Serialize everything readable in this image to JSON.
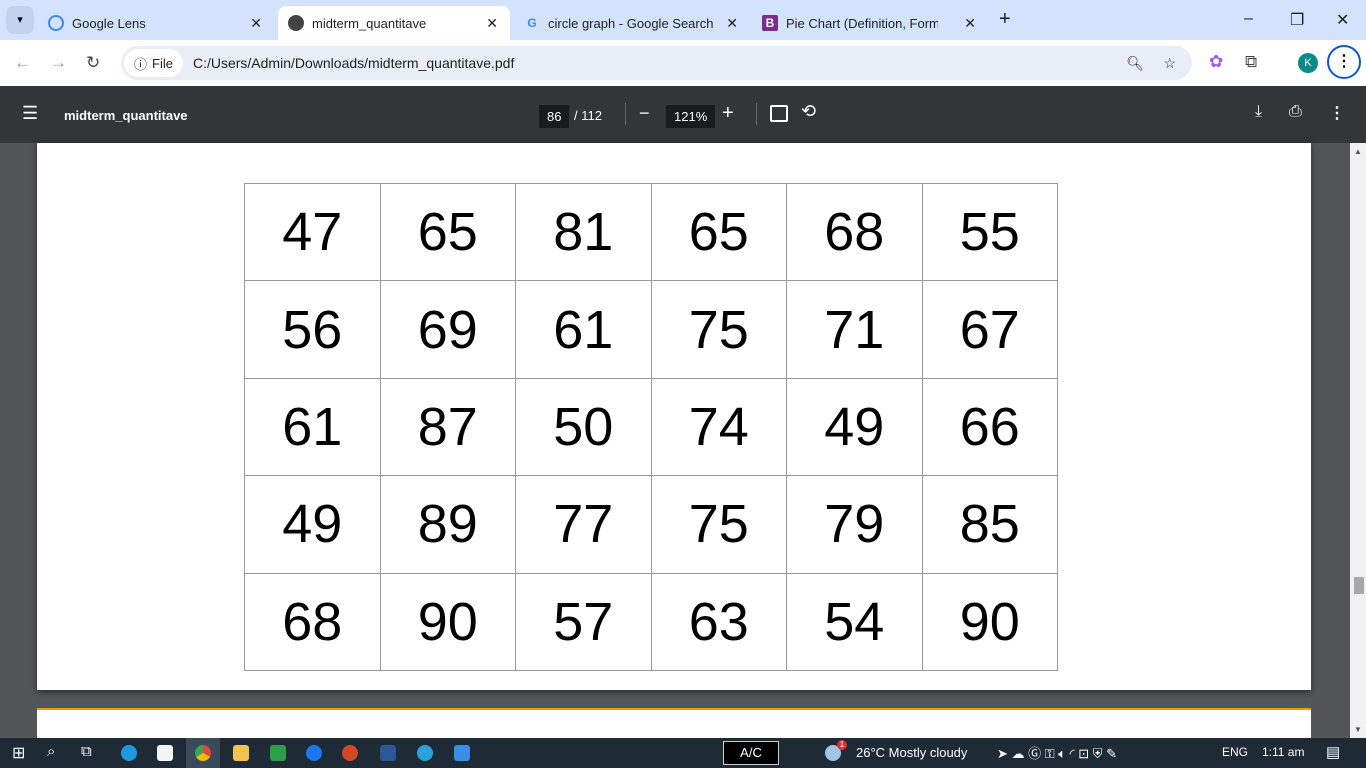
{
  "browser": {
    "tabs": [
      {
        "title": "Google Lens",
        "icon": "google-lens-icon",
        "active": false
      },
      {
        "title": "midterm_quantitave",
        "icon": "globe-icon",
        "active": true
      },
      {
        "title": "circle graph - Google Search",
        "icon": "google-icon",
        "active": false
      },
      {
        "title": "Pie Chart (Definition, Formula, E",
        "icon": "byjus-icon",
        "active": false
      }
    ],
    "address_chip": "File",
    "url": "C:/Users/Admin/Downloads/midterm_quantitave.pdf",
    "profile_initial": "K"
  },
  "pdf": {
    "title": "midterm_quantitave",
    "page_current": "86",
    "page_total": "/ 112",
    "zoom": "121%"
  },
  "table": {
    "rows": [
      [
        "47",
        "65",
        "81",
        "65",
        "68",
        "55"
      ],
      [
        "56",
        "69",
        "61",
        "75",
        "71",
        "67"
      ],
      [
        "61",
        "87",
        "50",
        "74",
        "49",
        "66"
      ],
      [
        "49",
        "89",
        "77",
        "75",
        "79",
        "85"
      ],
      [
        "68",
        "90",
        "57",
        "63",
        "54",
        "90"
      ]
    ]
  },
  "taskbar": {
    "ac_label": "A/C",
    "weather": "26°C  Mostly cloudy",
    "weather_badge": "1",
    "language": "ENG",
    "time": "1:11 am"
  }
}
